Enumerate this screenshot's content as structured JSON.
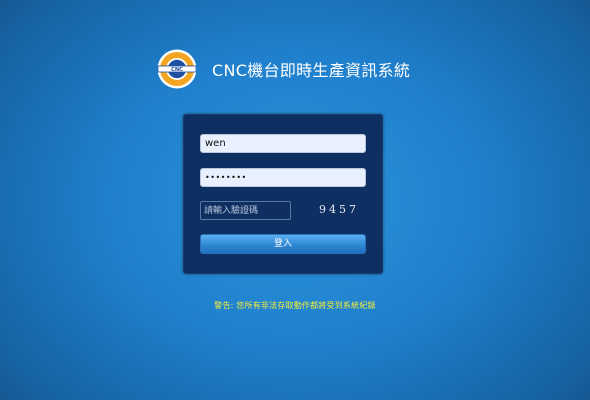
{
  "header": {
    "logo_text": "CNC",
    "title": "CNC機台即時生產資訊系統"
  },
  "login": {
    "username_value": "wen",
    "password_value": "••••••••",
    "captcha_placeholder": "請輸入驗證碼",
    "captcha_code": "9457",
    "submit_label": "登入"
  },
  "footer": {
    "warning": "警告: 您所有非法存取動作都將受到系統紀錄"
  },
  "colors": {
    "panel": "#0d2f61",
    "warning_text": "#f4ee3a",
    "logo_ring": "#f3a521",
    "logo_core": "#1f4fa0"
  }
}
